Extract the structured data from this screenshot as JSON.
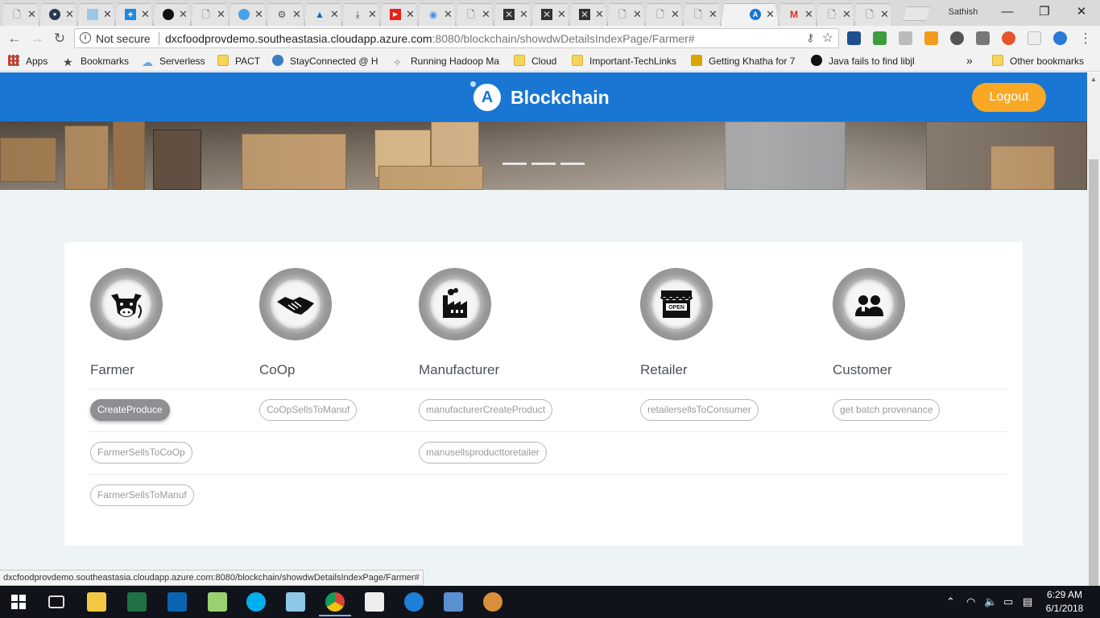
{
  "browser": {
    "tabs": [
      {
        "icon": "page-icon"
      },
      {
        "icon": "circle-icon"
      },
      {
        "icon": "image-icon"
      },
      {
        "icon": "plus-icon"
      },
      {
        "icon": "github-icon"
      },
      {
        "icon": "page-icon"
      },
      {
        "icon": "edge-icon"
      },
      {
        "icon": "network-icon"
      },
      {
        "icon": "azure-icon"
      },
      {
        "icon": "download-icon"
      },
      {
        "icon": "youtube-icon"
      },
      {
        "icon": "globe-icon"
      },
      {
        "icon": "page-icon"
      },
      {
        "icon": "x-icon"
      },
      {
        "icon": "x-icon"
      },
      {
        "icon": "x-icon"
      },
      {
        "icon": "page-icon"
      },
      {
        "icon": "page-icon"
      },
      {
        "icon": "page-icon"
      },
      {
        "icon": "azure-blue-icon"
      },
      {
        "icon": "gmail-icon"
      },
      {
        "icon": "page-icon"
      },
      {
        "icon": "page-icon"
      }
    ],
    "profile_name": "Sathish",
    "security_label": "Not secure",
    "url_host": "dxcfoodprovdemo.southeastasia.cloudapp.azure.com",
    "url_rest": ":8080/blockchain/showdwDetailsIndexPage/Farmer#",
    "status_url": "dxcfoodprovdemo.southeastasia.cloudapp.azure.com:8080/blockchain/showdwDetailsIndexPage/Farmer#",
    "bookmarks": [
      {
        "label": "Apps"
      },
      {
        "label": "Bookmarks"
      },
      {
        "label": "Serverless"
      },
      {
        "label": "PACT"
      },
      {
        "label": "StayConnected @ H"
      },
      {
        "label": "Running Hadoop Ma"
      },
      {
        "label": "Cloud"
      },
      {
        "label": "Important-TechLinks"
      },
      {
        "label": "Getting Khatha for 7"
      },
      {
        "label": "Java fails to find libjl"
      }
    ],
    "bookmarks_more": "»",
    "other_bookmarks": "Other bookmarks"
  },
  "app": {
    "brand_title": "Blockchain",
    "brand_logo_letter": "A",
    "logout_label": "Logout",
    "roles": [
      {
        "name": "Farmer",
        "icon": "cow-icon"
      },
      {
        "name": "CoOp",
        "icon": "handshake-icon"
      },
      {
        "name": "Manufacturer",
        "icon": "factory-icon"
      },
      {
        "name": "Retailer",
        "icon": "store-icon"
      },
      {
        "name": "Customer",
        "icon": "people-icon"
      }
    ],
    "store_sign": "OPEN",
    "actions": {
      "farmer": [
        "CreateProduce",
        "FarmerSellsToCoOp",
        "FarmerSellsToManuf"
      ],
      "coop": [
        "CoOpSellsToManuf"
      ],
      "manufacturer": [
        "manufacturerCreateProduct",
        "manusellsproducttoretailer"
      ],
      "retailer": [
        "retailersellsToConsumer"
      ],
      "customer": [
        "get batch provenance"
      ]
    },
    "active_action": "CreateProduce"
  },
  "taskbar": {
    "time": "6:29 AM",
    "date": "6/1/2018"
  },
  "colors": {
    "header_blue": "#1976d2",
    "logout_orange": "#f9a825",
    "active_pill": "#8d8f92"
  }
}
